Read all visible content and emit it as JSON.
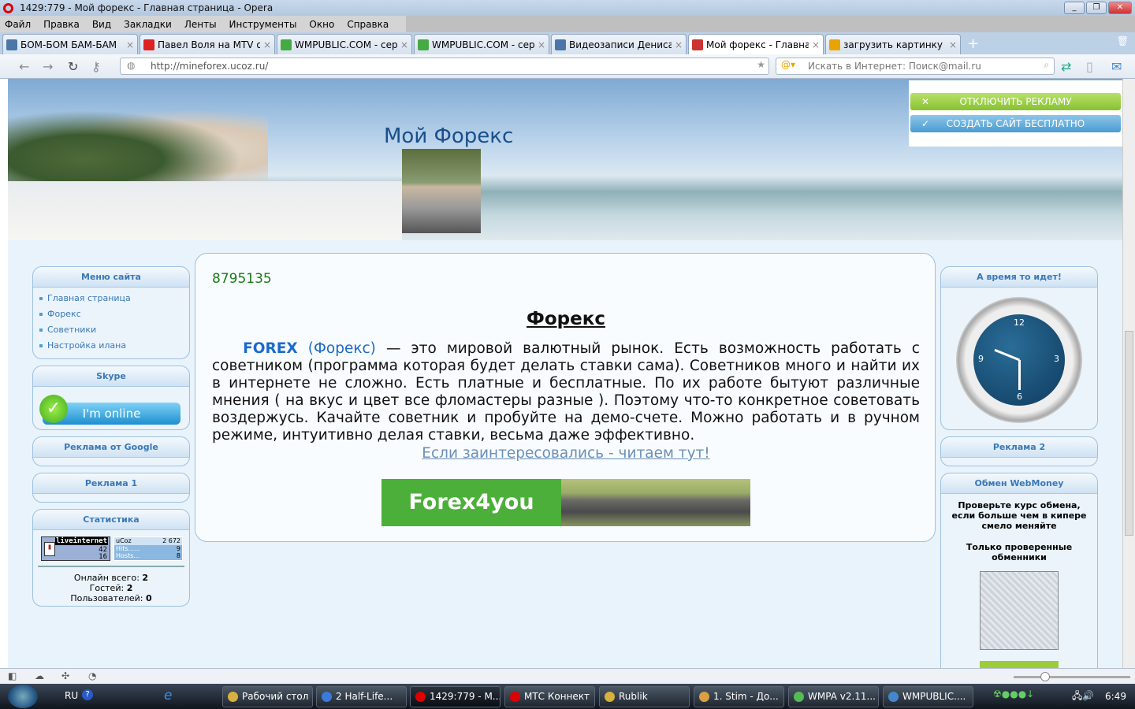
{
  "window": {
    "title": "1429:779 - Мой форекс - Главная страница - Opera"
  },
  "menu": [
    "Файл",
    "Правка",
    "Вид",
    "Закладки",
    "Ленты",
    "Инструменты",
    "Окно",
    "Справка"
  ],
  "tabs": [
    {
      "label": "БОМ-БОМ БАМ-БАМ",
      "icon": "vk-icon",
      "color": "#4a76a8"
    },
    {
      "label": "Павел Воля на MTV о...",
      "icon": "youtube-icon",
      "color": "#d22"
    },
    {
      "label": "WMPUBLIC.COM - сер...",
      "icon": "wmpublic-icon",
      "color": "#4a4"
    },
    {
      "label": "WMPUBLIC.COM - сер...",
      "icon": "wmpublic-icon",
      "color": "#4a4"
    },
    {
      "label": "Видеозаписи Дениса ...",
      "icon": "vk-icon",
      "color": "#4a76a8"
    },
    {
      "label": "Мой форекс - Главна...",
      "icon": "home-icon",
      "color": "#c33",
      "active": true
    },
    {
      "label": "загрузить картинку - З...",
      "icon": "mail-search-icon",
      "color": "#e9a400"
    }
  ],
  "address": {
    "url": "http://mineforex.ucoz.ru/",
    "search_placeholder": "Искать в Интернет: Поиск@mail.ru"
  },
  "site": {
    "title": "Мой Форекс",
    "ads": {
      "disable": "ОТКЛЮЧИТЬ РЕКЛАМУ",
      "create": "СОЗДАТЬ САЙТ БЕСПЛАТНО"
    },
    "left": {
      "menu_title": "Меню сайта",
      "menu": [
        "Главная страница",
        "Форекс",
        "Советники",
        "Настройка илана"
      ],
      "skype_title": "Skype",
      "skype_status": "I'm online",
      "google_title": "Реклама от Google",
      "ad1_title": "Реклама 1",
      "stats_title": "Статистика",
      "li": {
        "name": "liveinternet",
        "v1": "42",
        "v2": "16"
      },
      "ucoz": {
        "name": "uCoz",
        "total": "2 672",
        "hits_label": "Hits......",
        "hits": "9",
        "hosts_label": "Hosts...",
        "hosts": "8"
      },
      "online_label": "Онлайн всего:",
      "online": "2",
      "guests_label": "Гостей:",
      "guests": "2",
      "users_label": "Пользователей:",
      "users": "0"
    },
    "content": {
      "counter": "8795135",
      "title": "Форекс",
      "fx": "FOREX",
      "fx2": "(Форекс)",
      "body": " — это мировой валютный рынок. Есть возможность работать с советником (программа которая будет делать ставки сама). Советников много и найти их в интернете не сложно. Есть платные и бесплатные. По их работе бытуют различные мнения ( на вкус и цвет все фломастеры разные ). Поэтому что-то конкретное советовать воздержусь. Качайте советник и пробуйте на демо-счете. Можно  работать и в ручном режиме, интуитивно делая ставки, весьма даже эффективно.",
      "read_more": "Если заинтересовались - читаем тут!",
      "banner": "Forex4you"
    },
    "right": {
      "clock_title": "А время то идет!",
      "clock_numbers": [
        "12",
        "3",
        "6",
        "9"
      ],
      "ad2_title": "Реклама 2",
      "wm_title": "Обмен WebMoney",
      "wm_text1": "Проверьте курс обмена, если больше чем в кипере смело меняйте",
      "wm_text2": "Только проверенные обменники"
    }
  },
  "taskbar": {
    "lang": "RU",
    "items": [
      {
        "label": "Рабочий стол",
        "color": "#d8b040"
      },
      {
        "label": "2 Half-Life...",
        "color": "#3a7ad8"
      },
      {
        "label": "1429:779 - M...",
        "color": "#d00"
      },
      {
        "label": "МТС Коннект",
        "color": "#d00"
      },
      {
        "label": "Rublik",
        "color": "#d8b040"
      },
      {
        "label": "1. Stim - До...",
        "color": "#d8a040"
      },
      {
        "label": "WMPA v2.11...",
        "color": "#5b5"
      },
      {
        "label": "WMPUBLIC....",
        "color": "#48c"
      }
    ],
    "time": "6:49"
  }
}
